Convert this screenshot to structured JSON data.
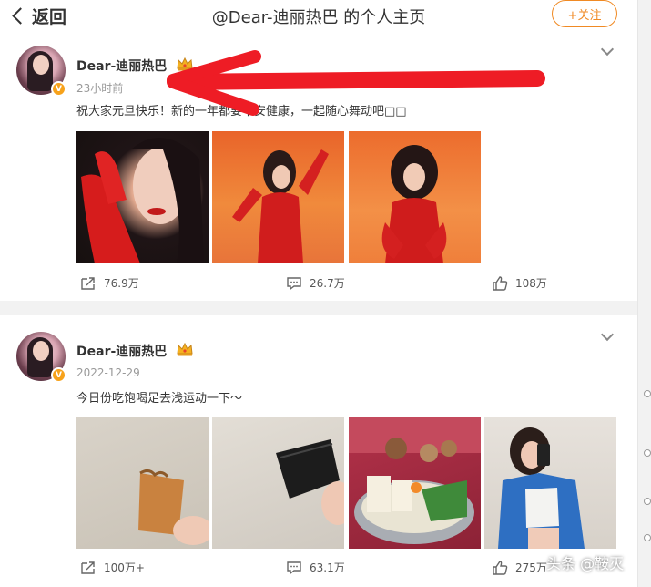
{
  "header": {
    "back_label": "返回",
    "title": "@Dear-迪丽热巴 的个人主页",
    "follow_label": "+关注"
  },
  "posts": [
    {
      "username": "Dear-迪丽热巴",
      "time": "23小时前",
      "text": "祝大家元旦快乐！新的一年都要平安健康，一起随心舞动吧□□",
      "photos": [
        "red-gloves-portrait",
        "red-dress-orange-bg-1",
        "red-dress-orange-bg-2"
      ],
      "repost_count": "76.9万",
      "comment_count": "26.7万",
      "like_count": "108万"
    },
    {
      "username": "Dear-迪丽热巴",
      "time": "2022-12-29",
      "text": "今日份吃饱喝足去浅运动一下～",
      "photos": [
        "snack-in-hand",
        "black-bag-in-hand",
        "hotpot-table",
        "mirror-selfie-blue-cardigan"
      ],
      "repost_count": "100万+",
      "comment_count": "63.1万",
      "like_count": "275万"
    }
  ],
  "watermark": "头条 @鞍灭",
  "colors": {
    "accent": "#f08a24",
    "annotation_arrow": "#ee1c25",
    "verified_badge": "#f7a21b"
  }
}
